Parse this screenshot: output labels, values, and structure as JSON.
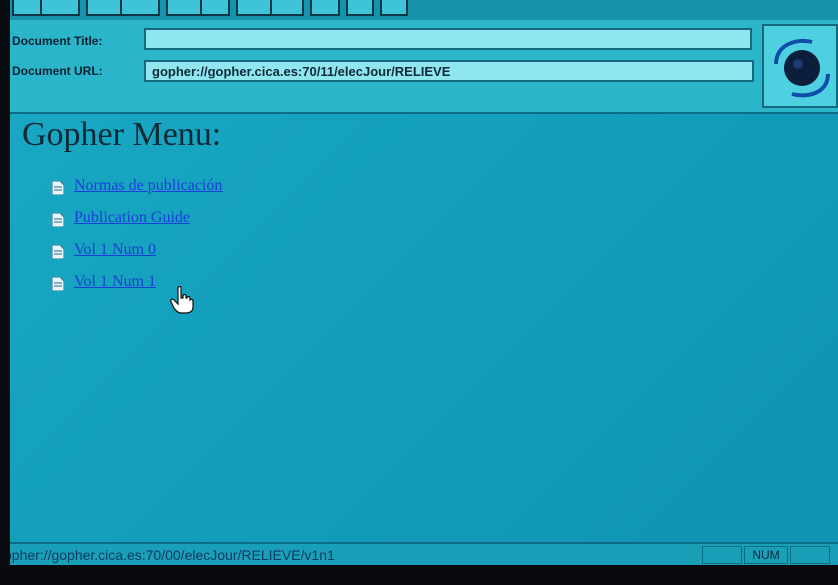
{
  "window": {
    "title_label": "Document Title:",
    "title_value": "",
    "url_label": "Document URL:",
    "url_value": "gopher://gopher.cica.es:70/11/elecJour/RELIEVE"
  },
  "page": {
    "heading": "Gopher Menu:",
    "items": [
      {
        "label": "Normas de publicación",
        "icon": "document-icon"
      },
      {
        "label": "Publication Guide",
        "icon": "document-icon"
      },
      {
        "label": "Vol 1 Num 0",
        "icon": "document-icon"
      },
      {
        "label": "Vol 1 Num 1",
        "icon": "document-icon"
      }
    ]
  },
  "status": {
    "text": "opher://gopher.cica.es:70/00/elecJour/RELIEVE/v1n1",
    "num_indicator": "NUM"
  },
  "colors": {
    "background": "#14a0bd",
    "link": "#1a3fd8",
    "panel": "#2ab5cb"
  }
}
